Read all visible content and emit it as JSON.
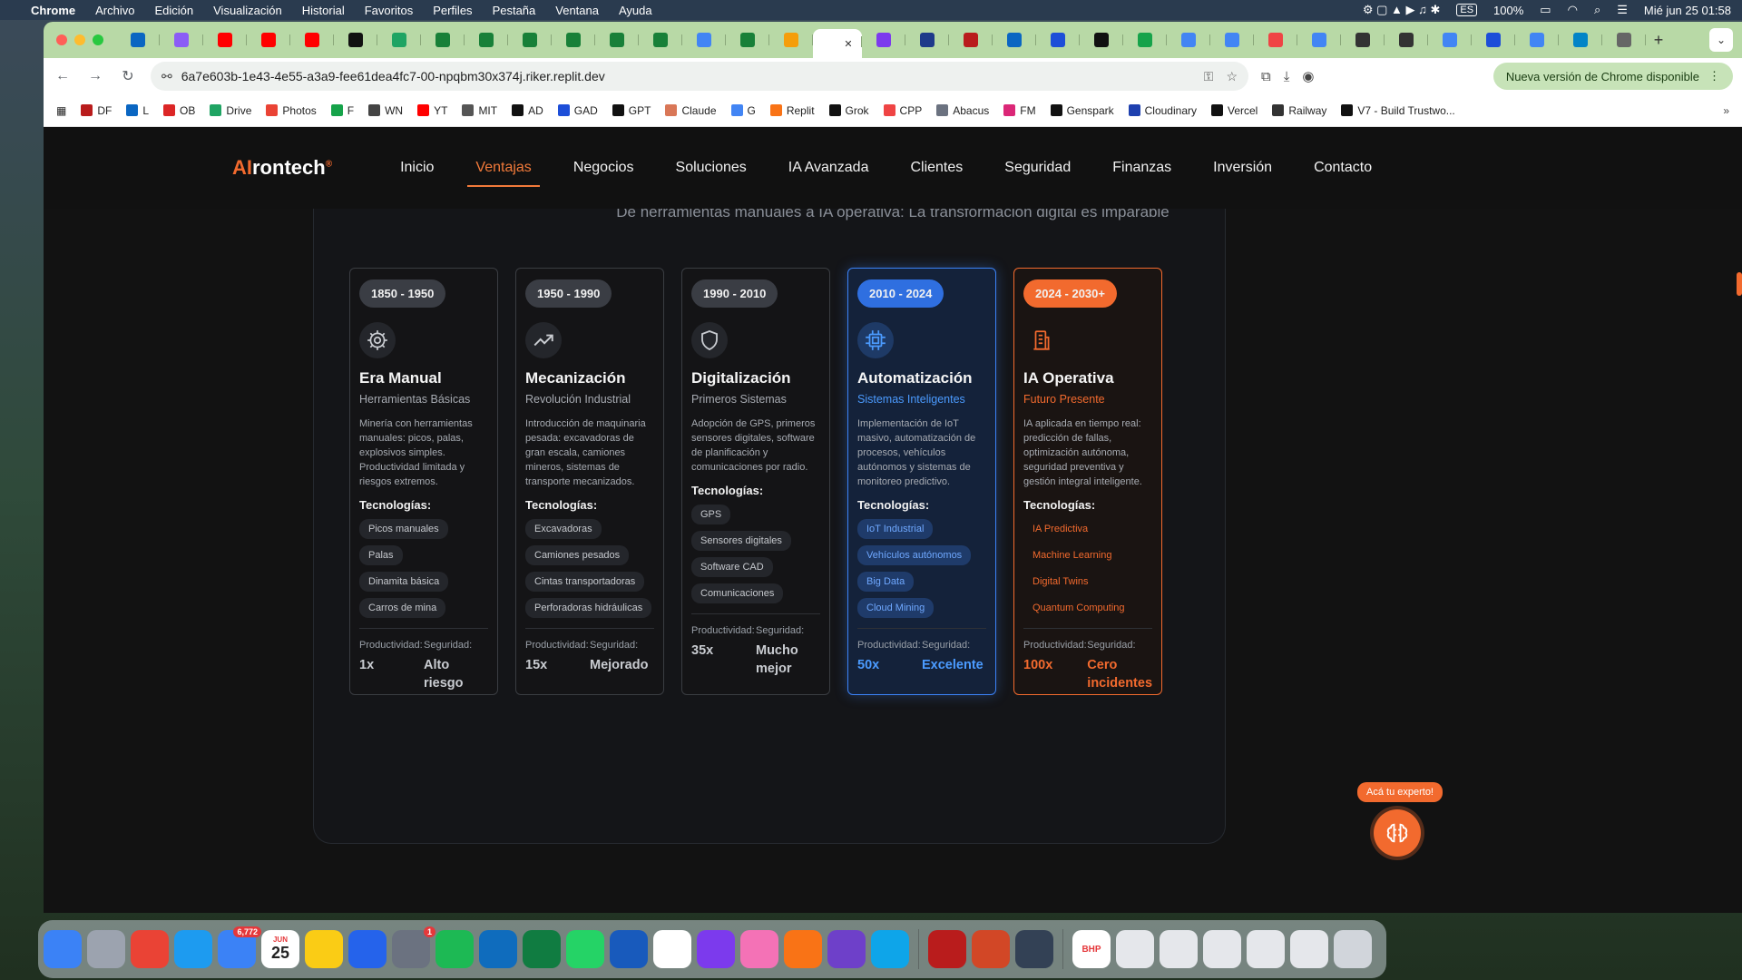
{
  "menubar": {
    "apple": "",
    "app": "Chrome",
    "items": [
      "Archivo",
      "Edición",
      "Visualización",
      "Historial",
      "Favoritos",
      "Perfiles",
      "Pestaña",
      "Ventana",
      "Ayuda"
    ],
    "battery": "100%",
    "clock": "Mié jun 25  01:58",
    "lang": "ES"
  },
  "browser": {
    "url": "6a7e603b-1e43-4e55-a3a9-fee61dea4fc7-00-npqbm30x374j.riker.replit.dev",
    "update_label": "Nueva versión de Chrome disponible",
    "bookmarks": [
      "DF",
      "L",
      "OB",
      "Drive",
      "Photos",
      "F",
      "WN",
      "YT",
      "MIT",
      "AD",
      "GAD",
      "GPT",
      "Claude",
      "G",
      "Replit",
      "Grok",
      "CPP",
      "Abacus",
      "FM",
      "Genspark",
      "Cloudinary",
      "Vercel",
      "Railway",
      "V7 - Build Trustwo..."
    ]
  },
  "site": {
    "logo_ai": "AI",
    "logo_rest": "rontech",
    "logo_sup": "®",
    "nav": [
      "Inicio",
      "Ventajas",
      "Negocios",
      "Soluciones",
      "IA Avanzada",
      "Clientes",
      "Seguridad",
      "Finanzas",
      "Inversión",
      "Contacto"
    ],
    "subtitle": "De herramientas manuales a IA operativa: La transformación digital es imparable",
    "tech_label": "Tecnologías:",
    "prod_label": "Productividad:",
    "seg_label": "Seguridad:",
    "expert_label": "Acá tu experto!",
    "cards": [
      {
        "period": "1850 - 1950",
        "title": "Era Manual",
        "subtitle": "Herramientas Básicas",
        "desc": "Minería con herramientas manuales: picos, palas, explosivos simples. Productividad limitada y riesgos extremos.",
        "tags": [
          "Picos manuales",
          "Palas",
          "Dinamita básica",
          "Carros de mina"
        ],
        "prod": "1x",
        "seg": "Alto riesgo"
      },
      {
        "period": "1950 - 1990",
        "title": "Mecanización",
        "subtitle": "Revolución Industrial",
        "desc": "Introducción de maquinaria pesada: excavadoras de gran escala, camiones mineros, sistemas de transporte mecanizados.",
        "tags": [
          "Excavadoras",
          "Camiones pesados",
          "Cintas transportadoras",
          "Perforadoras hidráulicas"
        ],
        "prod": "15x",
        "seg": "Mejorado"
      },
      {
        "period": "1990 - 2010",
        "title": "Digitalización",
        "subtitle": "Primeros Sistemas",
        "desc": "Adopción de GPS, primeros sensores digitales, software de planificación y comunicaciones por radio.",
        "tags": [
          "GPS",
          "Sensores digitales",
          "Software CAD",
          "Comunicaciones"
        ],
        "prod": "35x",
        "seg": "Mucho mejor"
      },
      {
        "period": "2010 - 2024",
        "title": "Automatización",
        "subtitle": "Sistemas Inteligentes",
        "desc": "Implementación de IoT masivo, automatización de procesos, vehículos autónomos y sistemas de monitoreo predictivo.",
        "tags": [
          "IoT Industrial",
          "Vehículos autónomos",
          "Big Data",
          "Cloud Mining"
        ],
        "prod": "50x",
        "seg": "Excelente"
      },
      {
        "period": "2024 - 2030+",
        "title": "IA Operativa",
        "subtitle": "Futuro Presente",
        "desc": "IA aplicada en tiempo real: predicción de fallas, optimización autónoma, seguridad preventiva y gestión integral inteligente.",
        "tags": [
          "IA Predictiva",
          "Machine Learning",
          "Digital Twins",
          "Quantum Computing"
        ],
        "prod": "100x",
        "seg": "Cero incidentes"
      }
    ]
  },
  "dock": {
    "mail_badge": "6,772",
    "settings_badge": "1",
    "calendar_month": "JUN",
    "calendar_day": "25",
    "bhp": "BHP"
  },
  "colors": {
    "accent": "#f26a2e",
    "blue": "#3b82f6"
  }
}
